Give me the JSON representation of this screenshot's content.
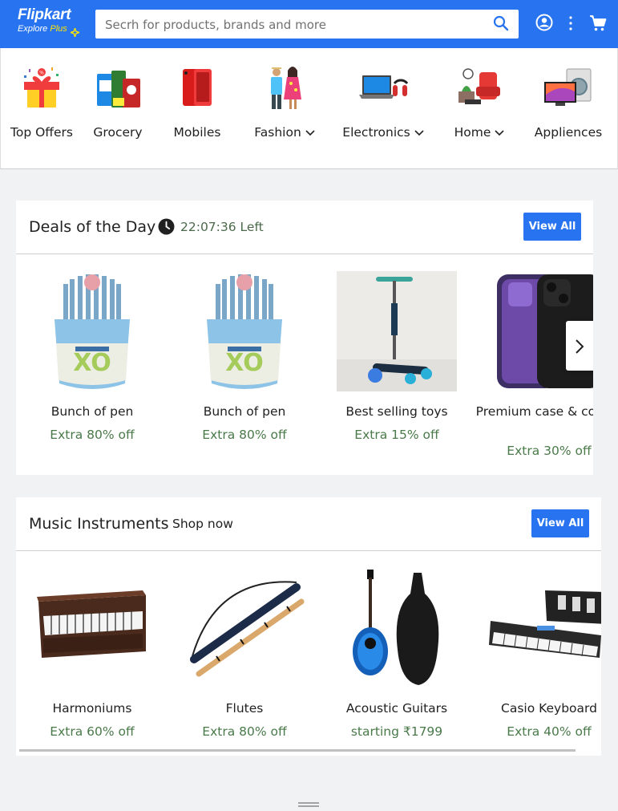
{
  "header": {
    "logo": "Flipkart",
    "logo_sub_explore": "Explore",
    "logo_sub_plus": "Plus",
    "search_placeholder": "Secrh for products, brands and more",
    "brand_color": "#2874f0"
  },
  "nav": {
    "items": [
      {
        "label": "Top Offers",
        "icon": "gift-icon"
      },
      {
        "label": "Grocery",
        "icon": "grocery-icon"
      },
      {
        "label": "Mobiles",
        "icon": "mobile-icon"
      },
      {
        "label": "Fashion",
        "icon": "fashion-icon"
      },
      {
        "label": "Electronics",
        "icon": "laptop-icon"
      },
      {
        "label": "Home",
        "icon": "home-icon"
      },
      {
        "label": "Appliences",
        "icon": "appliance-icon"
      }
    ]
  },
  "deals": {
    "title": "Deals of the Day",
    "timer": "22:07:36 Left",
    "view_all": "View All",
    "products": [
      {
        "name": "Bunch of pen",
        "offer": "Extra 80% off"
      },
      {
        "name": "Bunch of pen",
        "offer": "Extra 80% off"
      },
      {
        "name": "Best selling toys",
        "offer": "Extra 15% off"
      },
      {
        "name": "Premium case & covers",
        "offer": "Extra 30% off"
      }
    ]
  },
  "music": {
    "title": "Music Instruments",
    "subtitle": "Shop now",
    "view_all": "View All",
    "products": [
      {
        "name": "Harmoniums",
        "offer": "Extra 60% off"
      },
      {
        "name": "Flutes",
        "offer": "Extra 80% off"
      },
      {
        "name": "Acoustic Guitars",
        "offer": "starting ₹1799"
      },
      {
        "name": "Casio Keyboard",
        "offer": "Extra 40% off"
      }
    ]
  }
}
